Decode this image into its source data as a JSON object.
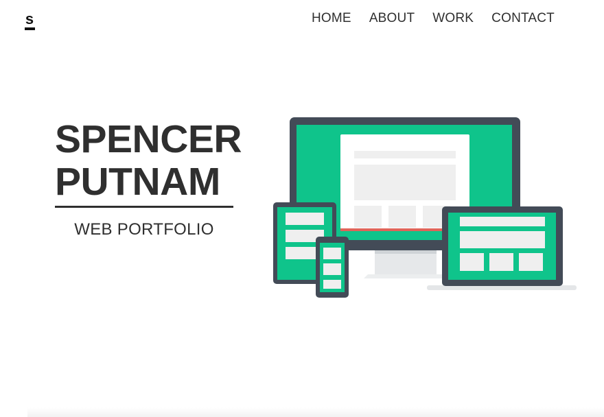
{
  "logo": {
    "letter": "s"
  },
  "nav": {
    "items": [
      {
        "label": "HOME"
      },
      {
        "label": "ABOUT"
      },
      {
        "label": "WORK"
      },
      {
        "label": "CONTACT"
      }
    ]
  },
  "hero": {
    "first_name": "SPENCER",
    "last_name": "PUTNAM",
    "subtitle": "WEB PORTFOLIO"
  },
  "colors": {
    "accent_green": "#0fc48b",
    "device_frame": "#434b57",
    "text": "#2f2f2f",
    "placeholder": "#efefef",
    "highlight_red": "#e0645a"
  },
  "illustration": {
    "icon": "responsive-devices-illustration"
  }
}
